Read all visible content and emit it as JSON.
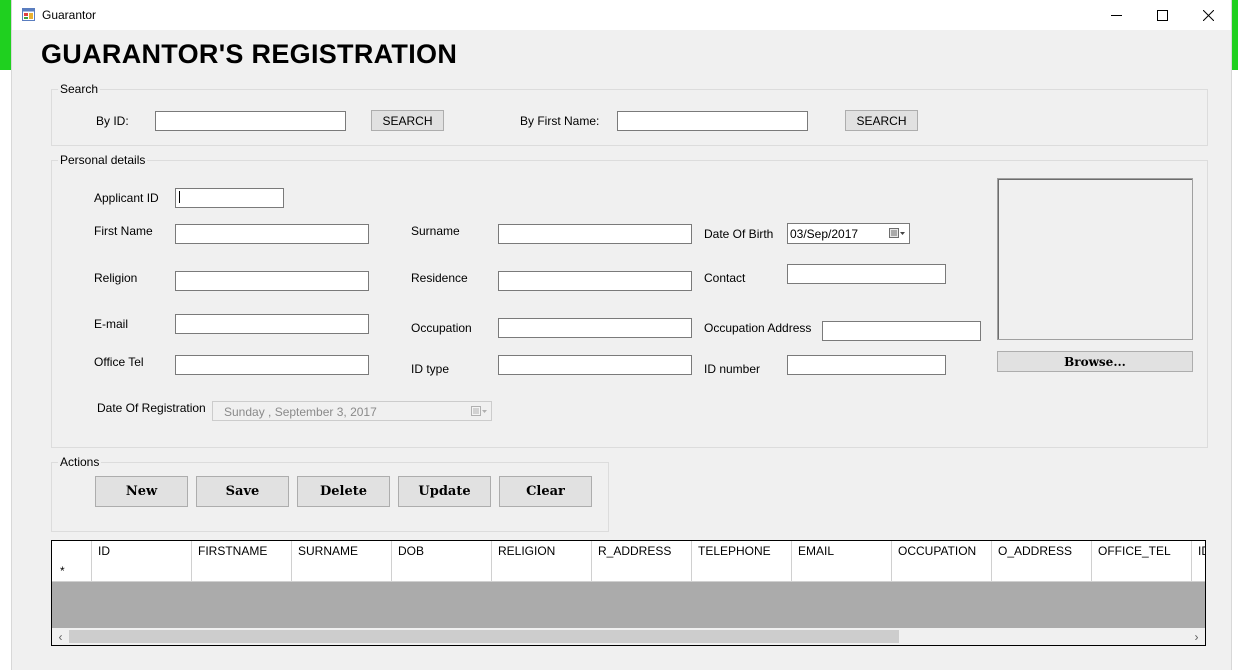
{
  "window": {
    "title": "Guarantor",
    "icon": "form-app-icon"
  },
  "heading": "GUARANTOR'S REGISTRATION",
  "search": {
    "legend": "Search",
    "by_id_label": "By ID:",
    "by_id_value": "",
    "search_label": "SEARCH",
    "by_first_name_label": "By First Name:",
    "by_first_name_value": ""
  },
  "personal": {
    "legend": "Personal details",
    "applicant_id_label": "Applicant ID",
    "first_name_label": "First Name",
    "surname_label": "Surname",
    "dob_label": "Date Of Birth",
    "dob_value": "03/Sep/2017",
    "religion_label": "Religion",
    "residence_label": "Residence",
    "contact_label": "Contact",
    "email_label": "E-mail",
    "occupation_label": "Occupation",
    "occupation_address_label": "Occupation Address",
    "office_tel_label": "Office Tel",
    "id_type_label": "ID type",
    "id_number_label": "ID number",
    "reg_date_label": "Date Of Registration",
    "reg_date_value": "Sunday   , September  3, 2017",
    "browse_label": "Browse..."
  },
  "actions": {
    "legend": "Actions",
    "new": "New",
    "save": "Save",
    "delete": "Delete",
    "update": "Update",
    "clear": "Clear"
  },
  "grid": {
    "columns": [
      "ID",
      "FIRSTNAME",
      "SURNAME",
      "DOB",
      "RELIGION",
      "R_ADDRESS",
      "TELEPHONE",
      "EMAIL",
      "OCCUPATION",
      "O_ADDRESS",
      "OFFICE_TEL",
      "ID"
    ],
    "new_row_marker": "*"
  },
  "colors": {
    "desktop_accent": "#1fd01f",
    "window_bg": "#f0f0f0",
    "grid_empty_bg": "#ababab"
  }
}
